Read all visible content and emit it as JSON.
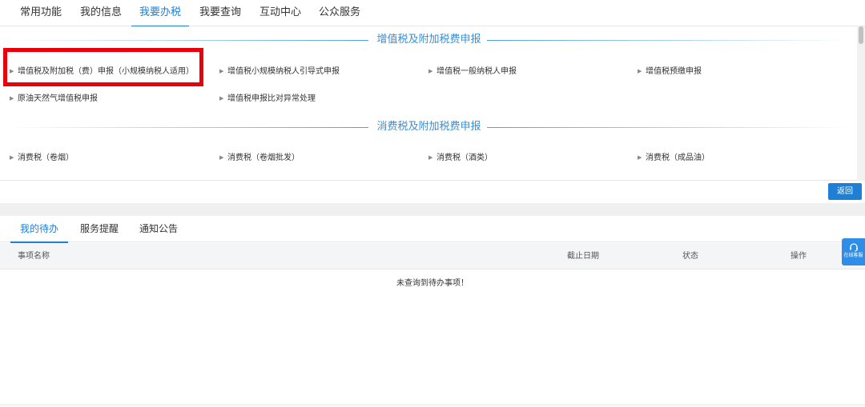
{
  "top_nav": [
    "常用功能",
    "我的信息",
    "我要办税",
    "我要查询",
    "互动中心",
    "公众服务"
  ],
  "vat_section": {
    "title": "增值税及附加税费申报",
    "items": [
      "增值税及附加税（费）申报（小规模纳税人适用）",
      "增值税小规模纳税人引导式申报",
      "增值税一般纳税人申报",
      "增值税预缴申报",
      "原油天然气增值税申报",
      "增值税申报比对异常处理"
    ]
  },
  "consumption_section": {
    "title": "消费税及附加税费申报",
    "items": [
      "消费税（卷烟）",
      "消费税（卷烟批发）",
      "消费税（酒类）",
      "消费税（成品油）"
    ]
  },
  "back_button": "返回",
  "bottom_tabs": [
    "我的待办",
    "服务提醒",
    "通知公告"
  ],
  "table": {
    "headers": [
      "事项名称",
      "截止日期",
      "状态",
      "操作"
    ],
    "empty_message": "未查询到待办事项！"
  },
  "service_button": "在线客服",
  "colors": {
    "accent": "#1e7fd4",
    "highlight": "#e8000b"
  }
}
